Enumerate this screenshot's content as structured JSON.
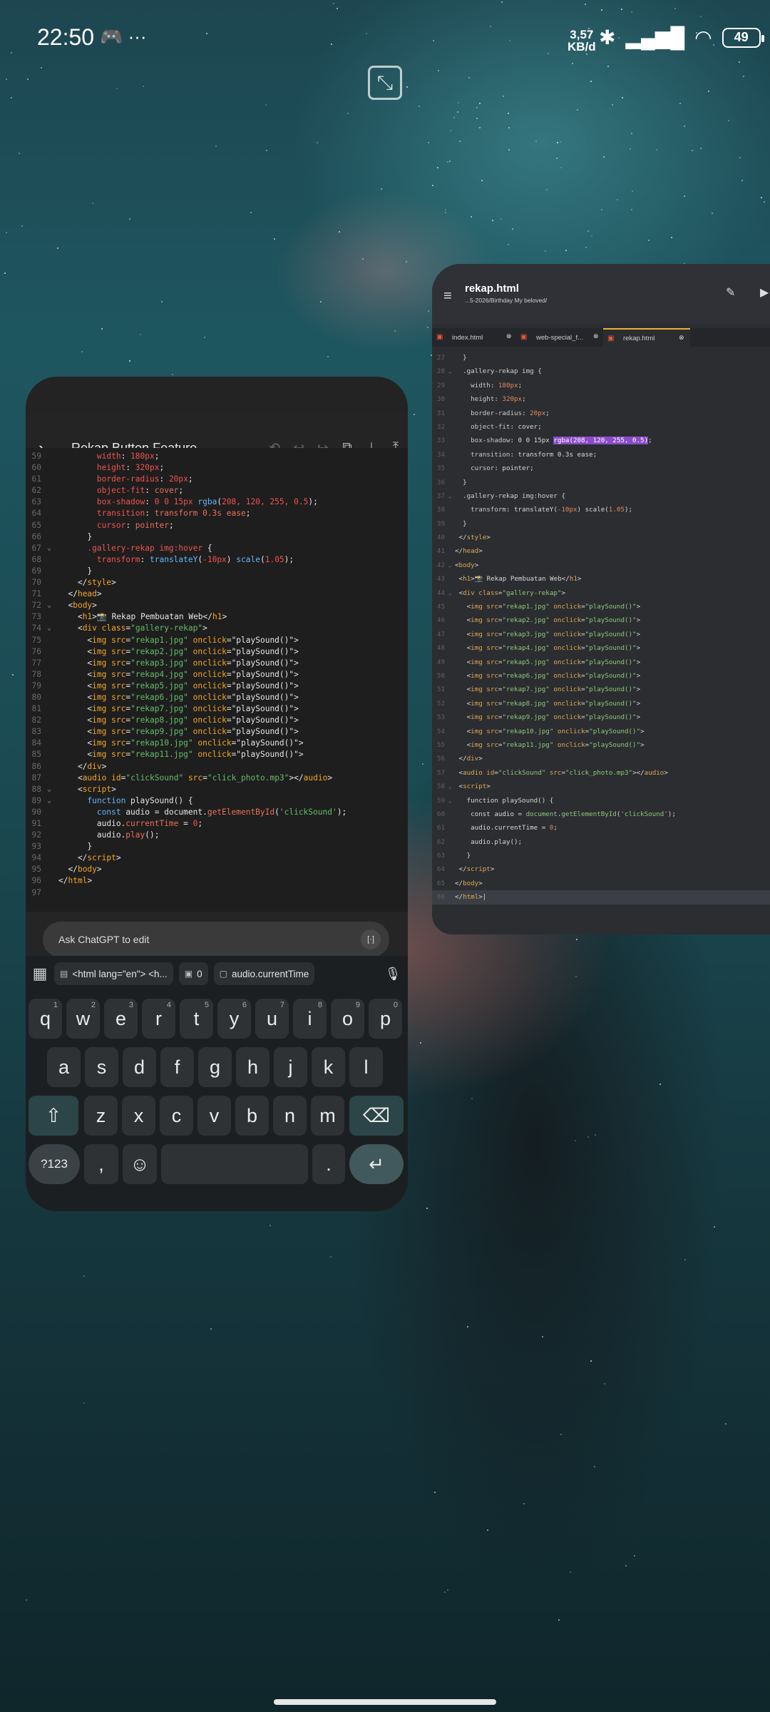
{
  "status": {
    "time": "22:50",
    "left_icons": [
      "discord-icon",
      "more-icon"
    ],
    "net_speed_value": "3,57",
    "net_speed_unit": "KB/d",
    "battery": "49"
  },
  "left_window": {
    "title": "Rekap Button Feature",
    "code_lines": [
      {
        "n": "59",
        "fold": "",
        "html": "        <span class='k-prop'>width</span>: <span class='k-num'>180px</span>;"
      },
      {
        "n": "60",
        "fold": "",
        "html": "        <span class='k-prop'>height</span>: <span class='k-num'>320px</span>;"
      },
      {
        "n": "61",
        "fold": "",
        "html": "        <span class='k-prop'>border-radius</span>: <span class='k-num'>20px</span>;"
      },
      {
        "n": "62",
        "fold": "",
        "html": "        <span class='k-prop'>object-fit</span>: <span class='k-val'>cover</span>;"
      },
      {
        "n": "63",
        "fold": "",
        "html": "        <span class='k-prop'>box-shadow</span>: <span class='k-num'>0 0 15px</span> <span class='k-fn'>rgba</span>(<span class='k-num'>208, 120, 255, 0.5</span>);"
      },
      {
        "n": "64",
        "fold": "",
        "html": "        <span class='k-prop'>transition</span>: <span class='k-val'>transform 0.3s ease</span>;"
      },
      {
        "n": "65",
        "fold": "",
        "html": "        <span class='k-prop'>cursor</span>: <span class='k-val'>pointer</span>;"
      },
      {
        "n": "66",
        "fold": "",
        "html": "      }"
      },
      {
        "n": "67",
        "fold": "v",
        "html": "      <span class='k-prop'>.gallery-rekap img:hover</span> {"
      },
      {
        "n": "68",
        "fold": "",
        "html": "        <span class='k-prop'>transform</span>: <span class='k-fn'>translateY</span>(<span class='k-num'>-10px</span>) <span class='k-fn'>scale</span>(<span class='k-num'>1.05</span>);"
      },
      {
        "n": "69",
        "fold": "",
        "html": "      }"
      },
      {
        "n": "70",
        "fold": "",
        "html": "    &lt;/<span class='k-tag'>style</span>&gt;"
      },
      {
        "n": "71",
        "fold": "",
        "html": "  &lt;/<span class='k-tag'>head</span>&gt;"
      },
      {
        "n": "72",
        "fold": "v",
        "html": "  &lt;<span class='k-tag'>body</span>&gt;"
      },
      {
        "n": "73",
        "fold": "",
        "html": "    &lt;<span class='k-tag'>h1</span>&gt;📸 Rekap Pembuatan Web&lt;/<span class='k-tag'>h1</span>&gt;"
      },
      {
        "n": "74",
        "fold": "v",
        "html": "    &lt;<span class='k-tag'>div</span> <span class='k-attr'>class</span>=<span class='k-str'>\"gallery-rekap\"</span>&gt;"
      },
      {
        "n": "75",
        "fold": "",
        "html": "      &lt;<span class='k-tag'>img</span> <span class='k-attr'>src</span>=<span class='k-str'>\"rekap1.jpg\"</span> <span class='k-attr'>onclick</span>=\"playSound()\"&gt;"
      },
      {
        "n": "76",
        "fold": "",
        "html": "      &lt;<span class='k-tag'>img</span> <span class='k-attr'>src</span>=<span class='k-str'>\"rekap2.jpg\"</span> <span class='k-attr'>onclick</span>=\"playSound()\"&gt;"
      },
      {
        "n": "77",
        "fold": "",
        "html": "      &lt;<span class='k-tag'>img</span> <span class='k-attr'>src</span>=<span class='k-str'>\"rekap3.jpg\"</span> <span class='k-attr'>onclick</span>=\"playSound()\"&gt;"
      },
      {
        "n": "78",
        "fold": "",
        "html": "      &lt;<span class='k-tag'>img</span> <span class='k-attr'>src</span>=<span class='k-str'>\"rekap4.jpg\"</span> <span class='k-attr'>onclick</span>=\"playSound()\"&gt;"
      },
      {
        "n": "79",
        "fold": "",
        "html": "      &lt;<span class='k-tag'>img</span> <span class='k-attr'>src</span>=<span class='k-str'>\"rekap5.jpg\"</span> <span class='k-attr'>onclick</span>=\"playSound()\"&gt;"
      },
      {
        "n": "80",
        "fold": "",
        "html": "      &lt;<span class='k-tag'>img</span> <span class='k-attr'>src</span>=<span class='k-str'>\"rekap6.jpg\"</span> <span class='k-attr'>onclick</span>=\"playSound()\"&gt;"
      },
      {
        "n": "81",
        "fold": "",
        "html": "      &lt;<span class='k-tag'>img</span> <span class='k-attr'>src</span>=<span class='k-str'>\"rekap7.jpg\"</span> <span class='k-attr'>onclick</span>=\"playSound()\"&gt;"
      },
      {
        "n": "82",
        "fold": "",
        "html": "      &lt;<span class='k-tag'>img</span> <span class='k-attr'>src</span>=<span class='k-str'>\"rekap8.jpg\"</span> <span class='k-attr'>onclick</span>=\"playSound()\"&gt;"
      },
      {
        "n": "83",
        "fold": "",
        "html": "      &lt;<span class='k-tag'>img</span> <span class='k-attr'>src</span>=<span class='k-str'>\"rekap9.jpg\"</span> <span class='k-attr'>onclick</span>=\"playSound()\"&gt;"
      },
      {
        "n": "84",
        "fold": "",
        "html": "      &lt;<span class='k-tag'>img</span> <span class='k-attr'>src</span>=<span class='k-str'>\"rekap10.jpg\"</span> <span class='k-attr'>onclick</span>=\"playSound()\"&gt;"
      },
      {
        "n": "85",
        "fold": "",
        "html": "      &lt;<span class='k-tag'>img</span> <span class='k-attr'>src</span>=<span class='k-str'>\"rekap11.jpg\"</span> <span class='k-attr'>onclick</span>=\"playSound()\"&gt;"
      },
      {
        "n": "86",
        "fold": "",
        "html": "    &lt;/<span class='k-tag'>div</span>&gt;"
      },
      {
        "n": "87",
        "fold": "",
        "html": "    &lt;<span class='k-tag'>audio</span> <span class='k-attr'>id</span>=<span class='k-str'>\"clickSound\"</span> <span class='k-attr'>src</span>=<span class='k-str'>\"click_photo.mp3\"</span>&gt;&lt;/<span class='k-tag'>audio</span>&gt;"
      },
      {
        "n": "88",
        "fold": "v",
        "html": "    &lt;<span class='k-tag'>script</span>&gt;"
      },
      {
        "n": "89",
        "fold": "v",
        "html": "      <span class='k-fn'>function</span> playSound() {"
      },
      {
        "n": "90",
        "fold": "",
        "html": "        <span class='k-fn'>const</span> audio = document.<span class='k-val'>getElementById</span>(<span class='k-str'>'clickSound'</span>);"
      },
      {
        "n": "91",
        "fold": "",
        "html": "        audio.<span class='k-val'>currentTime</span> = <span class='k-num'>0</span>;"
      },
      {
        "n": "92",
        "fold": "",
        "html": "        audio.<span class='k-val'>play</span>();"
      },
      {
        "n": "93",
        "fold": "",
        "html": "      }"
      },
      {
        "n": "94",
        "fold": "",
        "html": "    &lt;/<span class='k-tag'>script</span>&gt;"
      },
      {
        "n": "95",
        "fold": "",
        "html": "  &lt;/<span class='k-tag'>body</span>&gt;"
      },
      {
        "n": "96",
        "fold": "",
        "html": "&lt;/<span class='k-tag'>html</span>&gt;"
      },
      {
        "n": "97",
        "fold": "",
        "html": ""
      }
    ],
    "ask_placeholder": "Ask ChatGPT to edit",
    "suggestions": [
      "<html lang=\"en\"> <h...",
      "0",
      "audio.currentTime"
    ],
    "keyboard": {
      "row1": [
        {
          "k": "q",
          "h": "1"
        },
        {
          "k": "w",
          "h": "2"
        },
        {
          "k": "e",
          "h": "3"
        },
        {
          "k": "r",
          "h": "4"
        },
        {
          "k": "t",
          "h": "5"
        },
        {
          "k": "y",
          "h": "6"
        },
        {
          "k": "u",
          "h": "7"
        },
        {
          "k": "i",
          "h": "8"
        },
        {
          "k": "o",
          "h": "9"
        },
        {
          "k": "p",
          "h": "0"
        }
      ],
      "row2": [
        "a",
        "s",
        "d",
        "f",
        "g",
        "h",
        "j",
        "k",
        "l"
      ],
      "row3": [
        "z",
        "x",
        "c",
        "v",
        "b",
        "n",
        "m"
      ],
      "sym": "?123",
      "comma": ",",
      "period": "."
    }
  },
  "right_window": {
    "title": "rekap.html",
    "path": "...5-2026/Birthday My beloved/",
    "tabs": [
      "index.html",
      "web-special_f...",
      "rekap.html"
    ],
    "code_lines": [
      {
        "n": "27",
        "fold": "",
        "html": "  }"
      },
      {
        "n": "28",
        "fold": "v",
        "html": "  <span class='r-sel'>.gallery-rekap img</span> {"
      },
      {
        "n": "29",
        "fold": "",
        "html": "    <span class='r-prop'>width</span>: <span class='r-num'>180px</span>;"
      },
      {
        "n": "30",
        "fold": "",
        "html": "    <span class='r-prop'>height</span>: <span class='r-num'>320px</span>;"
      },
      {
        "n": "31",
        "fold": "",
        "html": "    <span class='r-prop'>border-radius</span>: <span class='r-num'>20px</span>;"
      },
      {
        "n": "32",
        "fold": "",
        "html": "    <span class='r-prop'>object-fit</span>: cover;"
      },
      {
        "n": "33",
        "fold": "",
        "html": "    <span class='r-prop'>box-shadow</span>: 0 0 15px <span class='hl'>rgba(208, 120, 255, 0.5)</span>;"
      },
      {
        "n": "34",
        "fold": "",
        "html": "    <span class='r-prop'>transition</span>: transform 0.3s ease;"
      },
      {
        "n": "35",
        "fold": "",
        "html": "    <span class='r-prop'>cursor</span>: pointer;"
      },
      {
        "n": "36",
        "fold": "",
        "html": "  }"
      },
      {
        "n": "37",
        "fold": "v",
        "html": "  <span class='r-sel'>.gallery-rekap img:hover</span> {"
      },
      {
        "n": "38",
        "fold": "",
        "html": "    <span class='r-prop'>transform</span>: translateY(<span class='r-num'>-10px</span>) scale(<span class='r-num'>1.05</span>);"
      },
      {
        "n": "39",
        "fold": "",
        "html": "  }"
      },
      {
        "n": "40",
        "fold": "",
        "html": " &lt;/<span class='r-tag'>style</span>&gt;"
      },
      {
        "n": "41",
        "fold": "",
        "html": "&lt;/<span class='r-tag'>head</span>&gt;"
      },
      {
        "n": "42",
        "fold": "v",
        "html": "&lt;<span class='r-tag'>body</span>&gt;"
      },
      {
        "n": "43",
        "fold": "",
        "html": " &lt;<span class='r-tag'>h1</span>&gt;📸 Rekap Pembuatan Web&lt;/<span class='r-tag'>h1</span>&gt;"
      },
      {
        "n": "44",
        "fold": "v",
        "html": " &lt;<span class='r-tag'>div</span> <span class='r-attr'>class</span>=<span class='r-str'>\"gallery-rekap\"</span>&gt;"
      },
      {
        "n": "45",
        "fold": "",
        "html": "   &lt;<span class='r-tag'>img</span> <span class='r-attr'>src</span>=<span class='r-str'>\"rekap1.jpg\"</span> <span class='r-attr'>onclick</span>=<span class='r-str'>\"playSound()\"</span>&gt;"
      },
      {
        "n": "46",
        "fold": "",
        "html": "   &lt;<span class='r-tag'>img</span> <span class='r-attr'>src</span>=<span class='r-str'>\"rekap2.jpg\"</span> <span class='r-attr'>onclick</span>=<span class='r-str'>\"playSound()\"</span>&gt;"
      },
      {
        "n": "47",
        "fold": "",
        "html": "   &lt;<span class='r-tag'>img</span> <span class='r-attr'>src</span>=<span class='r-str'>\"rekap3.jpg\"</span> <span class='r-attr'>onclick</span>=<span class='r-str'>\"playSound()\"</span>&gt;"
      },
      {
        "n": "48",
        "fold": "",
        "html": "   &lt;<span class='r-tag'>img</span> <span class='r-attr'>src</span>=<span class='r-str'>\"rekap4.jpg\"</span> <span class='r-attr'>onclick</span>=<span class='r-str'>\"playSound()\"</span>&gt;"
      },
      {
        "n": "49",
        "fold": "",
        "html": "   &lt;<span class='r-tag'>img</span> <span class='r-attr'>src</span>=<span class='r-str'>\"rekap5.jpg\"</span> <span class='r-attr'>onclick</span>=<span class='r-str'>\"playSound()\"</span>&gt;"
      },
      {
        "n": "50",
        "fold": "",
        "html": "   &lt;<span class='r-tag'>img</span> <span class='r-attr'>src</span>=<span class='r-str'>\"rekap6.jpg\"</span> <span class='r-attr'>onclick</span>=<span class='r-str'>\"playSound()\"</span>&gt;"
      },
      {
        "n": "51",
        "fold": "",
        "html": "   &lt;<span class='r-tag'>img</span> <span class='r-attr'>src</span>=<span class='r-str'>\"rekap7.jpg\"</span> <span class='r-attr'>onclick</span>=<span class='r-str'>\"playSound()\"</span>&gt;"
      },
      {
        "n": "52",
        "fold": "",
        "html": "   &lt;<span class='r-tag'>img</span> <span class='r-attr'>src</span>=<span class='r-str'>\"rekap8.jpg\"</span> <span class='r-attr'>onclick</span>=<span class='r-str'>\"playSound()\"</span>&gt;"
      },
      {
        "n": "53",
        "fold": "",
        "html": "   &lt;<span class='r-tag'>img</span> <span class='r-attr'>src</span>=<span class='r-str'>\"rekap9.jpg\"</span> <span class='r-attr'>onclick</span>=<span class='r-str'>\"playSound()\"</span>&gt;"
      },
      {
        "n": "54",
        "fold": "",
        "html": "   &lt;<span class='r-tag'>img</span> <span class='r-attr'>src</span>=<span class='r-str'>\"rekap10.jpg\"</span> <span class='r-attr'>onclick</span>=<span class='r-str'>\"playSound()\"</span>&gt;"
      },
      {
        "n": "55",
        "fold": "",
        "html": "   &lt;<span class='r-tag'>img</span> <span class='r-attr'>src</span>=<span class='r-str'>\"rekap11.jpg\"</span> <span class='r-attr'>onclick</span>=<span class='r-str'>\"playSound()\"</span>&gt;"
      },
      {
        "n": "56",
        "fold": "",
        "html": " &lt;/<span class='r-tag'>div</span>&gt;"
      },
      {
        "n": "57",
        "fold": "",
        "html": " &lt;<span class='r-tag'>audio</span> <span class='r-attr'>id</span>=<span class='r-str'>\"clickSound\"</span> <span class='r-attr'>src</span>=<span class='r-str'>\"click_photo.mp3\"</span>&gt;&lt;/<span class='r-tag'>audio</span>&gt;"
      },
      {
        "n": "58",
        "fold": "v",
        "html": " &lt;<span class='r-tag'>script</span>&gt;"
      },
      {
        "n": "59",
        "fold": "v",
        "html": "   function playSound() {"
      },
      {
        "n": "60",
        "fold": "",
        "html": "    const audio = <span class='r-str'>document</span>.<span class='r-str'>getElementById</span>(<span class='r-str'>'clickSound'</span>);"
      },
      {
        "n": "61",
        "fold": "",
        "html": "    audio.currentTime = <span class='r-num'>0</span>;"
      },
      {
        "n": "62",
        "fold": "",
        "html": "    audio.play();"
      },
      {
        "n": "63",
        "fold": "",
        "html": "   }"
      },
      {
        "n": "64",
        "fold": "",
        "html": " &lt;/<span class='r-tag'>script</span>&gt;"
      },
      {
        "n": "65",
        "fold": "",
        "html": "&lt;/<span class='r-tag'>body</span>&gt;"
      },
      {
        "n": "66",
        "fold": "",
        "html": "&lt;/<span class='r-tag'>html</span>&gt;|",
        "cur": true
      }
    ]
  }
}
